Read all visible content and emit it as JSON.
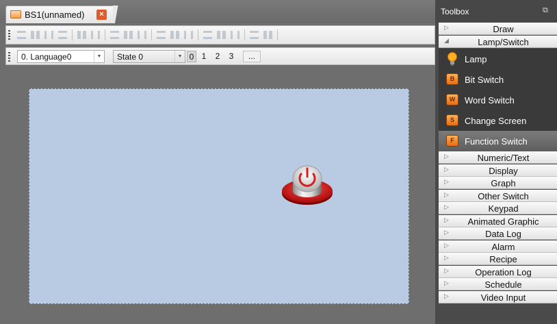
{
  "document_tab": {
    "label": "BS1(unnamed)",
    "close_glyph": "×"
  },
  "toolbar2": {
    "language": "0.  Language0",
    "state": "State 0",
    "state_buttons": [
      "0",
      "1",
      "2",
      "3"
    ],
    "more_label": "..."
  },
  "toolbox": {
    "title": "Toolbox",
    "categories_top": [
      {
        "label": "Draw",
        "expanded": false
      },
      {
        "label": "Lamp/Switch",
        "expanded": true
      }
    ],
    "items": [
      {
        "label": "Lamp",
        "icon": "lamp-icon"
      },
      {
        "label": "Bit Switch",
        "icon": "bit-switch-icon",
        "glyph": "B"
      },
      {
        "label": "Word Switch",
        "icon": "word-switch-icon",
        "glyph": "W"
      },
      {
        "label": "Change Screen",
        "icon": "change-screen-icon",
        "glyph": "S"
      },
      {
        "label": "Function Switch",
        "icon": "function-switch-icon",
        "glyph": "F",
        "selected": true
      }
    ],
    "categories_bottom": [
      "Numeric/Text",
      "Display",
      "Graph",
      "Other Switch",
      "Keypad",
      "Animated Graphic",
      "Data Log",
      "Alarm",
      "Recipe",
      "Operation Log",
      "Schedule",
      "Video Input"
    ]
  },
  "colors": {
    "canvas": "#b8cbe3",
    "accent_orange": "#f5a04c",
    "power_red": "#d21f1f"
  }
}
